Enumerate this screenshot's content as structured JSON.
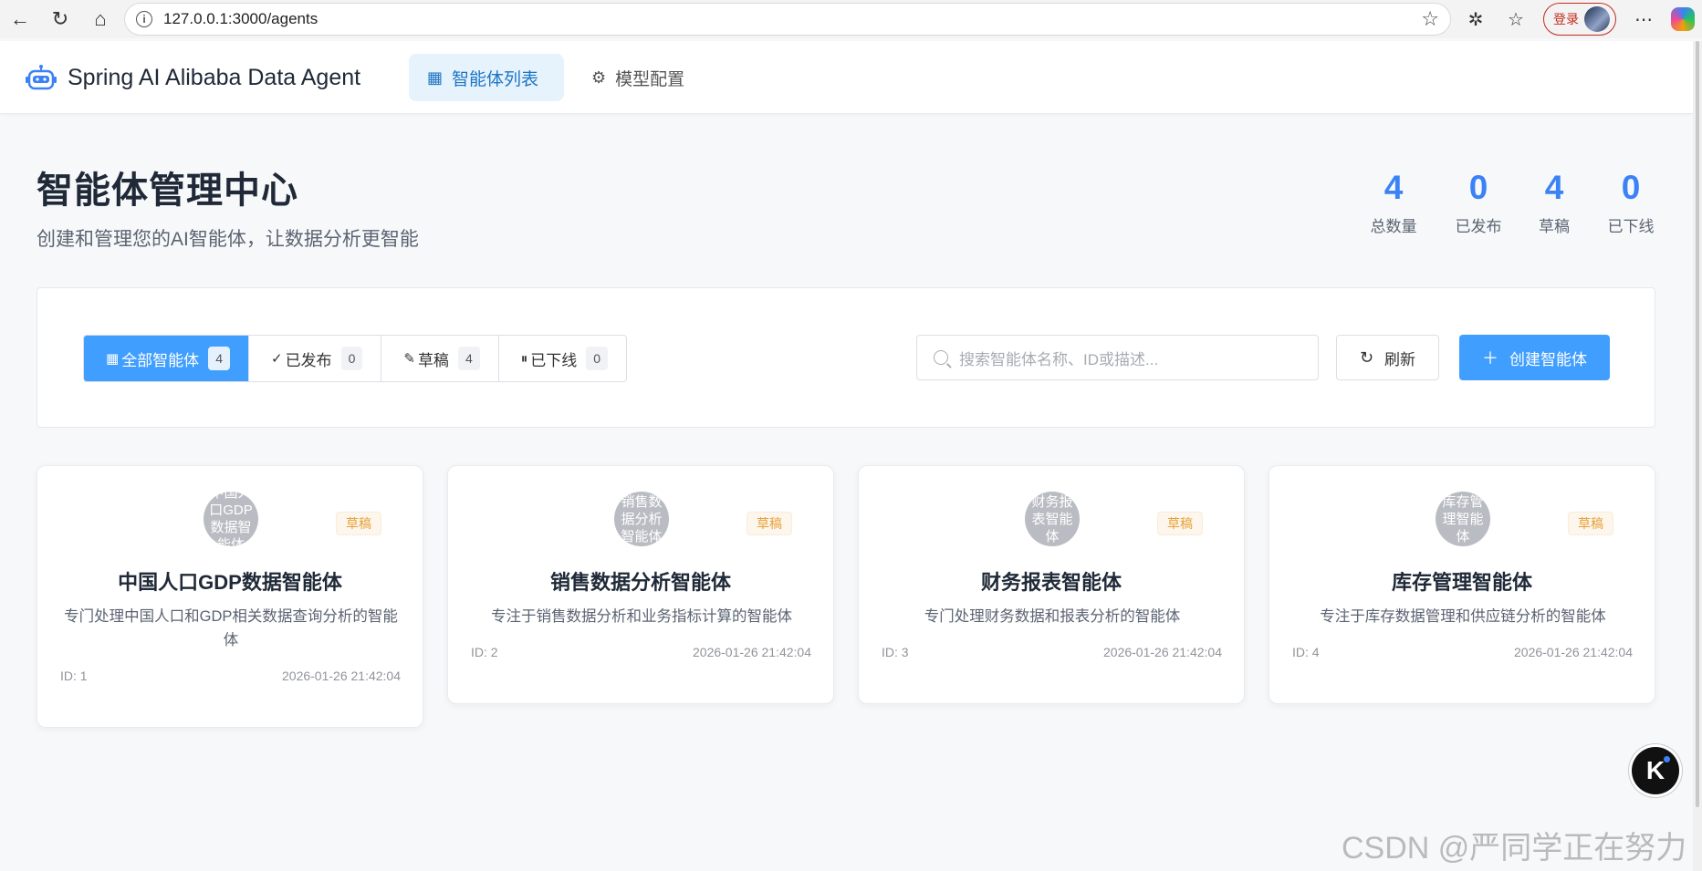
{
  "browser": {
    "url": "127.0.0.1:3000/agents",
    "login_label": "登录"
  },
  "header": {
    "app_title": "Spring AI Alibaba Data Agent",
    "tabs": [
      {
        "label": "智能体列表",
        "active": true
      },
      {
        "label": "模型配置",
        "active": false
      }
    ]
  },
  "hero": {
    "title": "智能体管理中心",
    "subtitle": "创建和管理您的AI智能体，让数据分析更智能",
    "stats": [
      {
        "value": "4",
        "label": "总数量"
      },
      {
        "value": "0",
        "label": "已发布"
      },
      {
        "value": "4",
        "label": "草稿"
      },
      {
        "value": "0",
        "label": "已下线"
      }
    ]
  },
  "filters": {
    "segments": [
      {
        "label": "全部智能体",
        "count": "4",
        "active": true
      },
      {
        "label": "已发布",
        "count": "0",
        "active": false
      },
      {
        "label": "草稿",
        "count": "4",
        "active": false
      },
      {
        "label": "已下线",
        "count": "0",
        "active": false
      }
    ],
    "search_placeholder": "搜索智能体名称、ID或描述...",
    "refresh_label": "刷新",
    "create_label": "创建智能体"
  },
  "agents": [
    {
      "avatar_text": "中国人口GDP数据智能体",
      "status": "草稿",
      "name": "中国人口GDP数据智能体",
      "description": "专门处理中国人口和GDP相关数据查询分析的智能体",
      "id": "ID: 1",
      "time": "2026-01-26 21:42:04"
    },
    {
      "avatar_text": "销售数据分析智能体",
      "status": "草稿",
      "name": "销售数据分析智能体",
      "description": "专注于销售数据分析和业务指标计算的智能体",
      "id": "ID: 2",
      "time": "2026-01-26 21:42:04"
    },
    {
      "avatar_text": "财务报表智能体",
      "status": "草稿",
      "name": "财务报表智能体",
      "description": "专门处理财务数据和报表分析的智能体",
      "id": "ID: 3",
      "time": "2026-01-26 21:42:04"
    },
    {
      "avatar_text": "库存管理智能体",
      "status": "草稿",
      "name": "库存管理智能体",
      "description": "专注于库存数据管理和供应链分析的智能体",
      "id": "ID: 4",
      "time": "2026-01-26 21:42:04"
    }
  ],
  "watermark": "CSDN @严同学正在努力",
  "colors": {
    "primary": "#409eff",
    "stat_blue": "#3b82f6",
    "draft_orange": "#e6a23c"
  }
}
